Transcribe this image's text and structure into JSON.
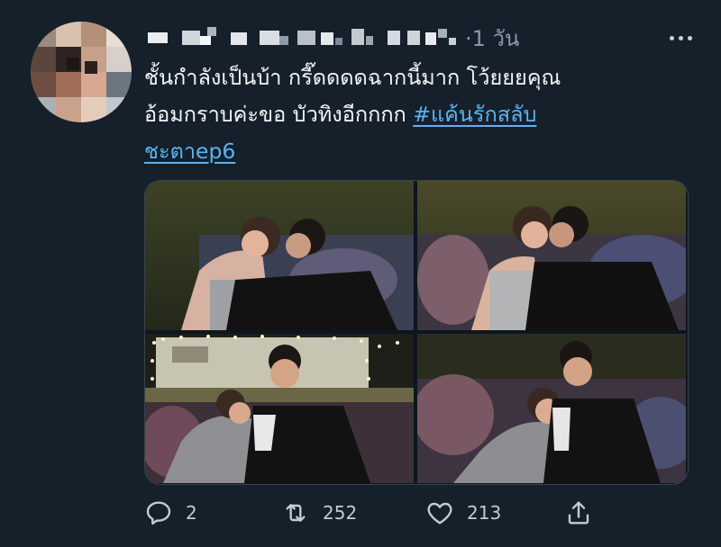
{
  "tweet": {
    "timestamp": "·1 วัน",
    "text_lines": [
      "ชั้นกำลังเป็นบ้า กรี๊ดดดดฉากนี้มาก โว้ยยยคุณ",
      "อ้อมกราบค่ะขอ บัวทิงอีกกกก "
    ],
    "hashtag_part1": "#แค้นรักสลับ",
    "hashtag_part2": "ชะตาep6"
  },
  "actions": {
    "reply_count": "2",
    "retweet_count": "252",
    "like_count": "213"
  },
  "icons": {
    "reply": "reply-icon",
    "retweet": "retweet-icon",
    "like": "heart-icon",
    "share": "share-icon",
    "more": "more-icon"
  },
  "colors": {
    "background": "#15202b",
    "hashtag": "#5ab3f0",
    "muted": "#8b98a5"
  }
}
